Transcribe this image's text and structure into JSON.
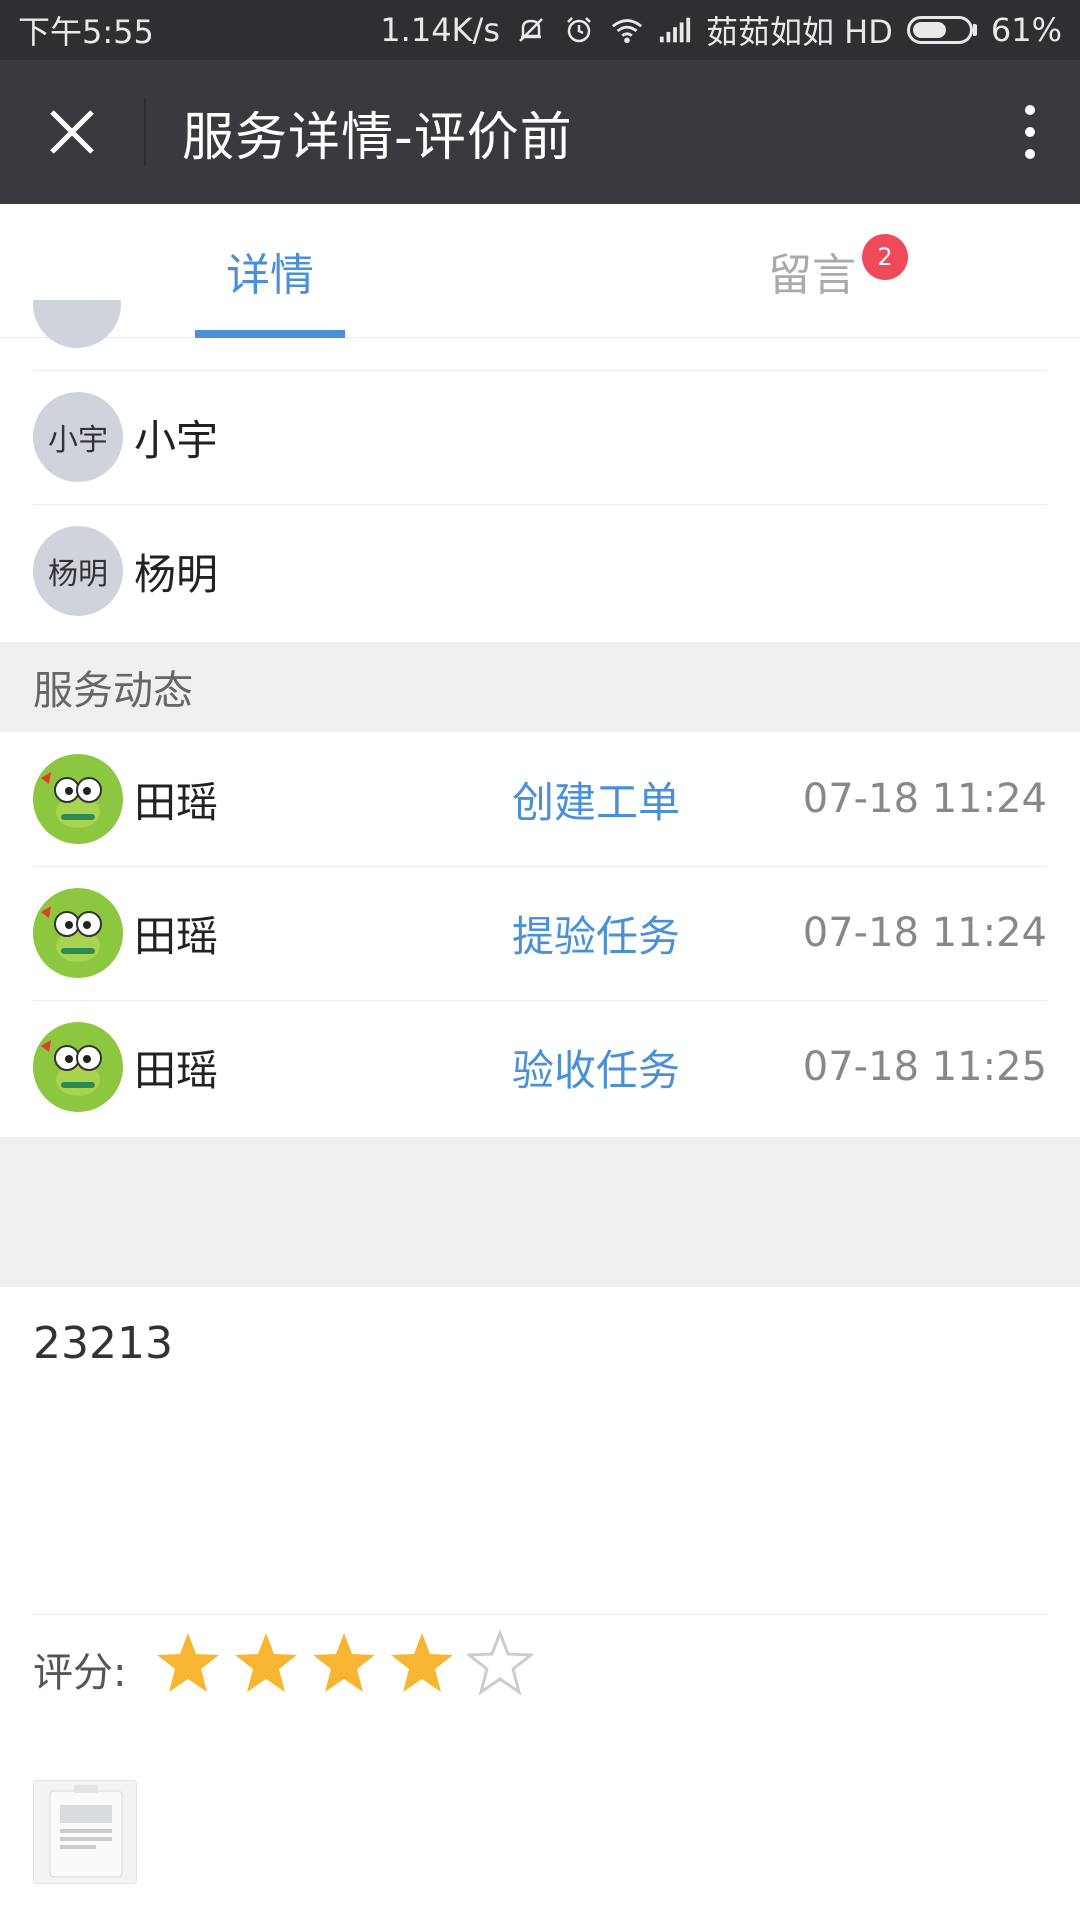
{
  "status_bar": {
    "time": "下午5:55",
    "network_speed": "1.14K/s",
    "carrier": "茹茹如如 HD",
    "battery": "61%",
    "battery_level": 0.61
  },
  "header": {
    "title": "服务详情-评价前"
  },
  "tabs": {
    "details_label": "详情",
    "messages_label": "留言",
    "messages_badge": "2"
  },
  "people": [
    {
      "avatar_text": "小宇",
      "name": "小宇"
    },
    {
      "avatar_text": "杨明",
      "name": "杨明"
    }
  ],
  "activity": {
    "section_title": "服务动态",
    "items": [
      {
        "name": "田瑶",
        "action": "创建工单",
        "time": "07-18 11:24"
      },
      {
        "name": "田瑶",
        "action": "提验任务",
        "time": "07-18 11:24"
      },
      {
        "name": "田瑶",
        "action": "验收任务",
        "time": "07-18 11:25"
      }
    ]
  },
  "note": {
    "text": "23213"
  },
  "rating": {
    "label": "评分:",
    "value": 4,
    "max": 5
  },
  "colors": {
    "accent": "#4a90d9",
    "header_bg": "#393a3f",
    "badge": "#ee4a5a",
    "star_filled": "#f7b532",
    "star_empty": "#c9ccd2"
  }
}
